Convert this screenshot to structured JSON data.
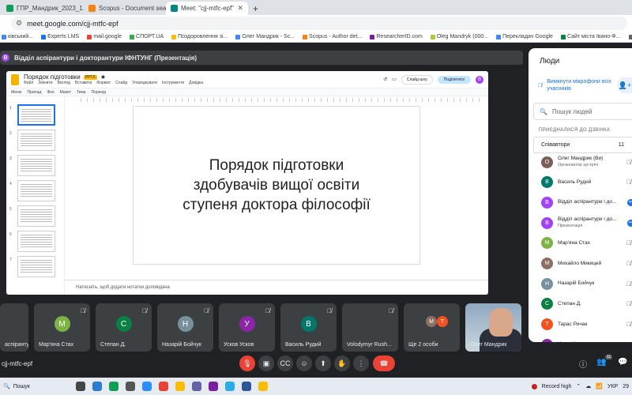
{
  "browser": {
    "tabs": [
      {
        "label": "ГПР_Мандрик_2023_1.xlsx - Go",
        "color": "#0f9d58",
        "active": false
      },
      {
        "label": "Scopus - Document search",
        "color": "#f68212",
        "active": false
      },
      {
        "label": "Meet: \"cjj-mtfc-epf\"",
        "color": "#00897b",
        "active": true
      }
    ],
    "new_tab_glyph": "+",
    "url": "meet.google.com/cjj-mtfc-epf",
    "bookmarks": [
      {
        "label": "ківський...",
        "color": "#4285f4"
      },
      {
        "label": "Experts LMS",
        "color": "#1a73e8"
      },
      {
        "label": "mail.google",
        "color": "#ea4335"
      },
      {
        "label": "СПОРТ.UA",
        "color": "#34a853"
      },
      {
        "label": "Поздоровлення зі...",
        "color": "#fbbc04"
      },
      {
        "label": "Олег Мандрик - Sc...",
        "color": "#4285f4"
      },
      {
        "label": "Scopus - Author det...",
        "color": "#f68212"
      },
      {
        "label": "ResearcherID.com",
        "color": "#7b1fa2"
      },
      {
        "label": "Oleg Mandryk (000...",
        "color": "#a6ce39"
      },
      {
        "label": "Перекладач Google",
        "color": "#4285f4"
      },
      {
        "label": "Сайт міста Івано-Ф...",
        "color": "#0b8043"
      },
      {
        "label": "Анкетування студе...",
        "color": "#5f6368"
      }
    ]
  },
  "presentation": {
    "presenter_initial": "В",
    "header": "Відділ аспірантури і докторантури ІФНТУНГ (Презентація)",
    "doc_title": "Порядок підготовки",
    "doc_badge": "PPTX",
    "menus": [
      "Файл",
      "Змінити",
      "Вигляд",
      "Вставити",
      "Формат",
      "Слайд",
      "Упорядкувати",
      "Інструменти",
      "Довідка"
    ],
    "slideshow_button": "Слайд-шоу",
    "share_button": "Поділитися",
    "user_initial": "В",
    "toolbar": [
      "Меню",
      "Прилад",
      "Фон",
      "Макет",
      "Тема",
      "Перехід"
    ],
    "thumb_numbers": [
      "1",
      "2",
      "3",
      "4",
      "5",
      "6",
      "7"
    ],
    "slide_text": "Порядок підготовки здобувачів вищої освіти ступеня доктора філософії",
    "notes_placeholder": "Натисніть, щоб додати нотатки доповідача"
  },
  "people_panel": {
    "title": "Люди",
    "mute_all": "Вимкнути мікрофони всіх учасників",
    "search_placeholder": "Пошук людей",
    "joined_label": "ПРИЄДНАЛИСЯ ДО ДЗВІНКА",
    "group_label": "Співавтори",
    "group_count": "11",
    "people": [
      {
        "name": "Олег Мандрик (Ви)",
        "sub": "Організатор зустрічі",
        "initial": "О",
        "color": "#7b5e57",
        "muted": true
      },
      {
        "name": "Василь Рудий",
        "sub": "",
        "initial": "В",
        "color": "#00796b",
        "muted": true
      },
      {
        "name": "Відділ аспірантури і до...",
        "sub": "",
        "initial": "В",
        "color": "#a142f4",
        "muted": false
      },
      {
        "name": "Відділ аспірантури і до...",
        "sub": "Презентація",
        "initial": "В",
        "color": "#a142f4",
        "muted": false
      },
      {
        "name": "Мар'яна Стах",
        "sub": "",
        "initial": "М",
        "color": "#7cb342",
        "muted": true
      },
      {
        "name": "Михайло Микицей",
        "sub": "",
        "initial": "М",
        "color": "#8d6e63",
        "muted": true
      },
      {
        "name": "Назарій Бойчук",
        "sub": "",
        "initial": "Н",
        "color": "#78909c",
        "muted": true
      },
      {
        "name": "Степан Д.",
        "sub": "",
        "initial": "С",
        "color": "#0b8043",
        "muted": true
      },
      {
        "name": "Тарас Ричак",
        "sub": "",
        "initial": "Т",
        "color": "#f4511e",
        "muted": true
      },
      {
        "name": "Усков Усков",
        "sub": "",
        "initial": "У",
        "color": "#8e24aa",
        "muted": true
      }
    ]
  },
  "tiles": [
    {
      "name": "аспіранту...",
      "initial": "",
      "color": "#3c4043",
      "muted": false
    },
    {
      "name": "Мар'яна Стах",
      "initial": "М",
      "color": "#7cb342",
      "muted": true
    },
    {
      "name": "Степан Д.",
      "initial": "С",
      "color": "#0b8043",
      "muted": true
    },
    {
      "name": "Назарій Бойчук",
      "initial": "Н",
      "color": "#78909c",
      "muted": true
    },
    {
      "name": "Усков Усков",
      "initial": "У",
      "color": "#8e24aa",
      "muted": true
    },
    {
      "name": "Василь Рудий",
      "initial": "В",
      "color": "#00796b",
      "muted": true
    },
    {
      "name": "Volodymyr Rush...",
      "initial": "",
      "color": "#3c4043",
      "muted": true
    },
    {
      "name": "Ще 2 особи",
      "initial": "",
      "color": "#3c4043",
      "muted": false
    },
    {
      "name": "Олег Мандрик",
      "initial": "",
      "color": "#3c4043",
      "muted": false
    }
  ],
  "more_people_initials": [
    "М",
    "Т"
  ],
  "meet_code": "cjj-mtfc-epf",
  "participants_badge": "11",
  "taskbar": {
    "search_label": "Пошук",
    "record_label": "Record high",
    "lang": "УКР",
    "clock": "29"
  }
}
